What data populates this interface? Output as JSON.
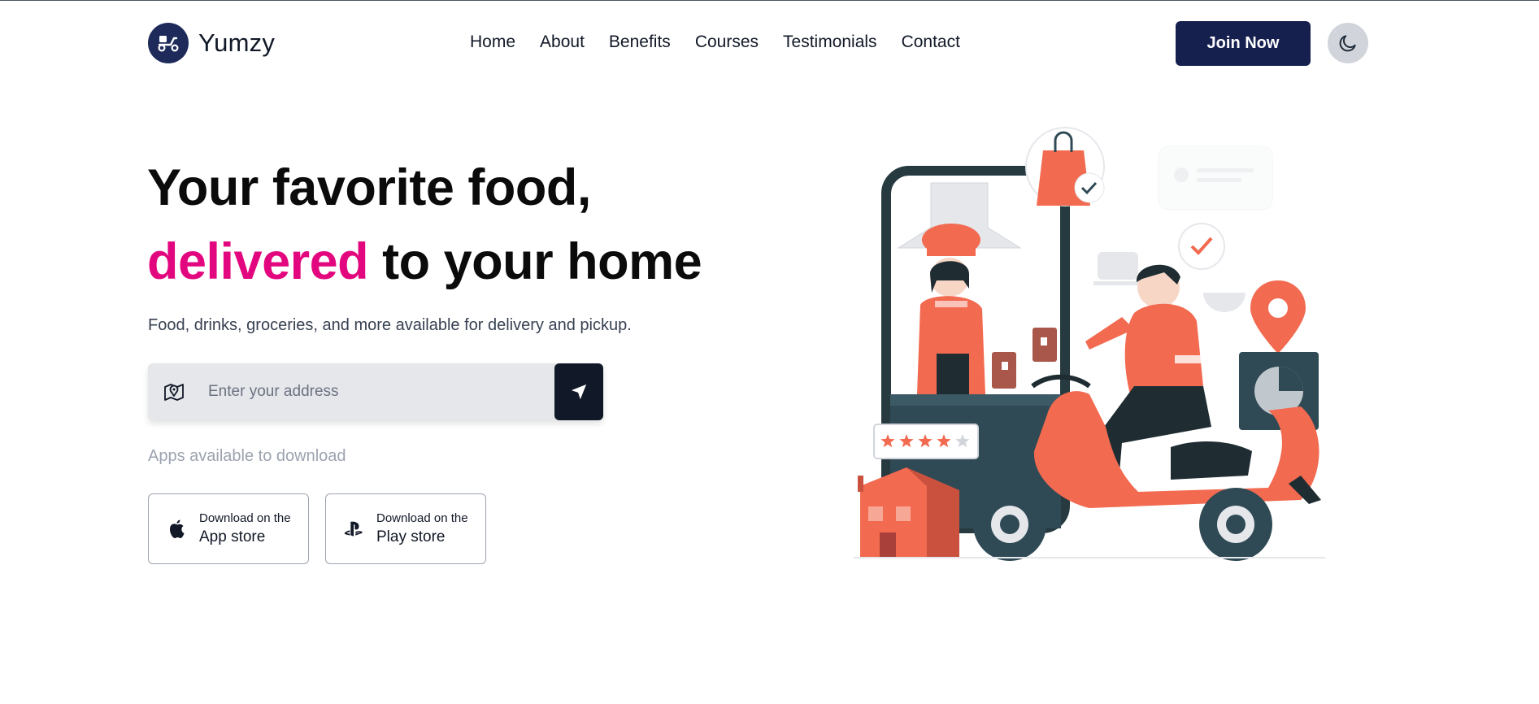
{
  "brand": {
    "name": "Yumzy",
    "logo_icon": "scooter-icon",
    "color": "#1e2a5a"
  },
  "nav": {
    "items": [
      {
        "label": "Home"
      },
      {
        "label": "About"
      },
      {
        "label": "Benefits"
      },
      {
        "label": "Courses"
      },
      {
        "label": "Testimonials"
      },
      {
        "label": "Contact"
      }
    ]
  },
  "header": {
    "join_label": "Join Now",
    "join_color": "#15204f",
    "theme_icon": "moon-icon"
  },
  "hero": {
    "title_line1": "Your favorite food,",
    "title_accent": "delivered",
    "title_rest": " to your home",
    "accent_color": "#e3077f",
    "subtitle": "Food, drinks, groceries, and more available for delivery and pickup."
  },
  "search": {
    "placeholder": "Enter your address",
    "value": "",
    "icon": "map-pin-icon",
    "button_icon": "navigation-arrow-icon"
  },
  "apps": {
    "label": "Apps available to download",
    "app_store": {
      "small": "Download on the",
      "big": "App store",
      "icon": "apple-icon"
    },
    "play_store": {
      "small": "Download on the",
      "big": "Play store",
      "icon": "playstation-icon"
    }
  },
  "illustration": {
    "rating_stars": 4,
    "rating_max": 5,
    "accent": "#f26a50",
    "dark": "#2f4a55"
  }
}
